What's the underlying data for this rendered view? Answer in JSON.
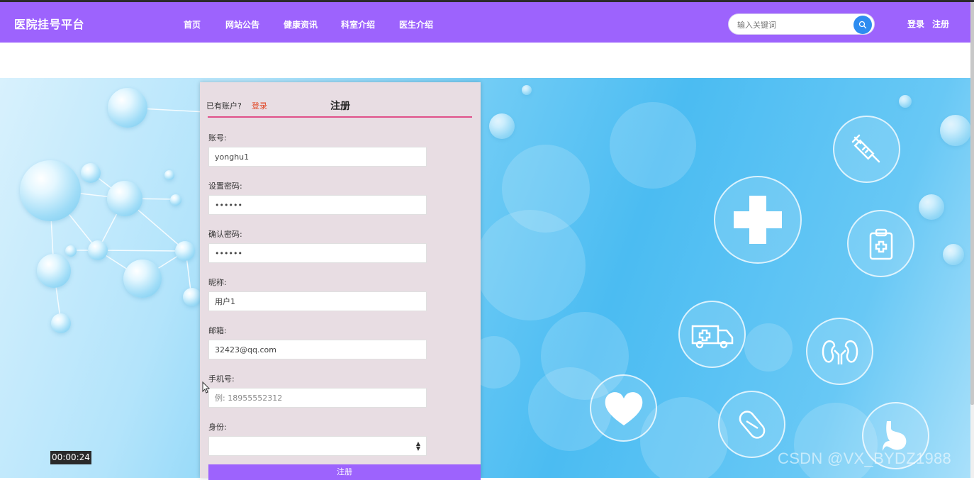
{
  "brand": "医院挂号平台",
  "nav": [
    {
      "label": "首页"
    },
    {
      "label": "网站公告"
    },
    {
      "label": "健康资讯"
    },
    {
      "label": "科室介绍"
    },
    {
      "label": "医生介绍"
    }
  ],
  "search": {
    "placeholder": "输入关键词",
    "icon": "search-icon"
  },
  "auth": {
    "login": "登录",
    "register": "注册"
  },
  "form": {
    "have_account": "已有账户?",
    "login_link": "登录",
    "title": "注册",
    "fields": [
      {
        "label": "账号:",
        "value": "yonghu1",
        "placeholder": ""
      },
      {
        "label": "设置密码:",
        "value": "••••••",
        "placeholder": ""
      },
      {
        "label": "确认密码:",
        "value": "••••••",
        "placeholder": ""
      },
      {
        "label": "昵称:",
        "value": "用户1",
        "placeholder": ""
      },
      {
        "label": "邮箱:",
        "value": "32423@qq.com",
        "placeholder": ""
      },
      {
        "label": "手机号:",
        "value": "",
        "placeholder": "例: 18955552312"
      }
    ],
    "identity_label": "身份:",
    "identity_value": "",
    "submit": "注册"
  },
  "video_timer": "00:00:24",
  "watermark": "CSDN @VX_BYDZ1988",
  "colors": {
    "primary": "#9d63fd",
    "accent_line": "#e0508a",
    "link": "#e04a2a",
    "search_btn": "#2d8cf0"
  }
}
